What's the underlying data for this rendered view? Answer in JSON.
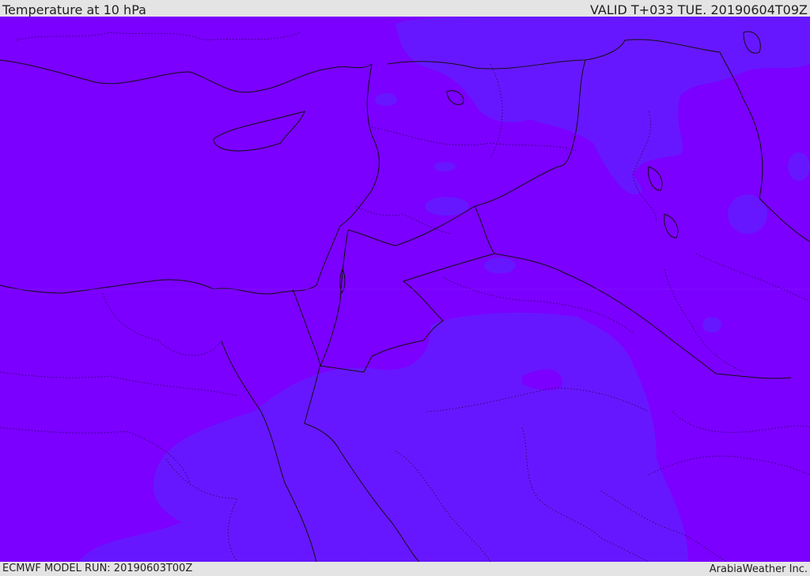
{
  "header": {
    "title": "Temperature at 10 hPa",
    "valid": "VALID T+033 TUE. 20190604T09Z"
  },
  "footer": {
    "model_run": "ECMWF MODEL RUN: 20190603T00Z",
    "credit": "ArabiaWeather Inc."
  },
  "map": {
    "field": "temperature",
    "level": "10 hPa",
    "colors": {
      "background_fill": "#7b00ff",
      "contour_fill_light": "#6717ff",
      "coastline": "#111111",
      "border": "#111111"
    }
  }
}
